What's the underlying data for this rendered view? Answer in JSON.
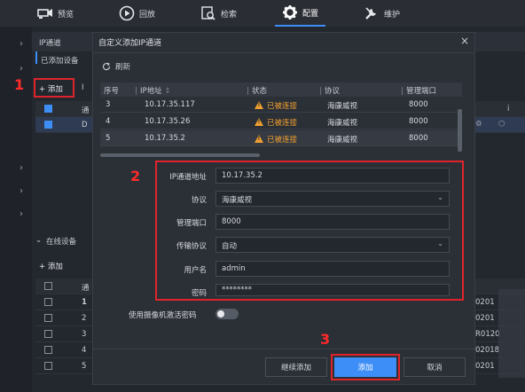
{
  "topnav": {
    "items": [
      {
        "label": "预览",
        "icon": "camera-icon"
      },
      {
        "label": "回放",
        "icon": "play-icon"
      },
      {
        "label": "检索",
        "icon": "search-doc-icon"
      },
      {
        "label": "配置",
        "icon": "gear-icon"
      },
      {
        "label": "维护",
        "icon": "wrench-icon"
      }
    ]
  },
  "background": {
    "tab_ip_channel": "IP通道",
    "added_devices": "已添加设备",
    "add_button": "+ 添加",
    "row_col_partial": "通",
    "row_device_partial": "D",
    "online_devices": "在线设备",
    "add_button_2": "+ 添加",
    "online_rows": [
      "1",
      "2",
      "3",
      "4",
      "5"
    ],
    "right_col_values": [
      "0201",
      "0201",
      "R0120",
      "02018",
      "0201"
    ],
    "right_col_i": "i"
  },
  "annotations": {
    "step1": "1",
    "step2": "2",
    "step3": "3"
  },
  "dialog": {
    "title": "自定义添加IP通道",
    "close": "×",
    "refresh_label": "刷新",
    "table": {
      "headers": [
        "序号",
        "IP地址",
        "状态",
        "协议",
        "管理端口"
      ],
      "rows": [
        {
          "index": "3",
          "ip": "10.17.35.117",
          "status": "已被连接",
          "protocol": "海康威视",
          "port": "8000"
        },
        {
          "index": "4",
          "ip": "10.17.35.26",
          "status": "已被连接",
          "protocol": "海康威视",
          "port": "8000"
        },
        {
          "index": "5",
          "ip": "10.17.35.2",
          "status": "已被连接",
          "protocol": "海康威视",
          "port": "8000"
        }
      ]
    },
    "form": {
      "ip_label": "IP通道地址",
      "ip_value": "10.17.35.2",
      "protocol_label": "协议",
      "protocol_value": "海康威视",
      "port_label": "管理端口",
      "port_value": "8000",
      "transport_label": "传输协议",
      "transport_value": "自动",
      "username_label": "用户名",
      "username_value": "admin",
      "password_label": "密码",
      "password_value": "********"
    },
    "toggle_label": "使用摄像机激活密码",
    "buttons": {
      "continue": "继续添加",
      "add": "添加",
      "cancel": "取消"
    }
  },
  "colors": {
    "accent": "#3e8ef7",
    "warning": "#f0a030",
    "annotation_red": "#e0242c"
  }
}
